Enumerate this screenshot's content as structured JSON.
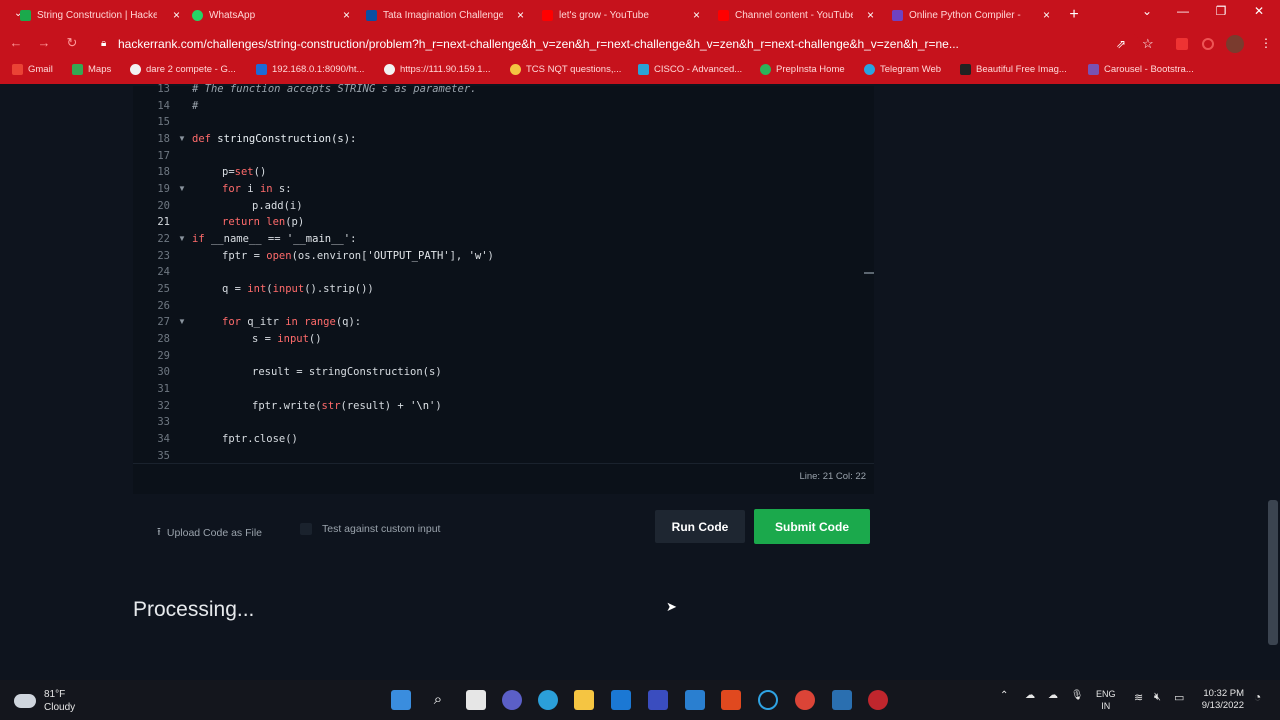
{
  "browser": {
    "tabs": [
      {
        "title": "String Construction | Hackerrank",
        "color": "#1ba94c"
      },
      {
        "title": "WhatsApp",
        "color": "#25d366"
      },
      {
        "title": "Tata Imagination Challenge",
        "color": "#0b4ea2"
      },
      {
        "title": "let's grow - YouTube",
        "color": "#ff0000"
      },
      {
        "title": "Channel content - YouTube",
        "color": "#ff0000"
      },
      {
        "title": "Online Python Compiler - ",
        "color": "#6f42c1"
      }
    ],
    "url": "hackerrank.com/challenges/string-construction/problem?h_r=next-challenge&h_v=zen&h_r=next-challenge&h_v=zen&h_r=next-challenge&h_v=zen&h_r=ne...",
    "bookmarks": [
      {
        "label": "Gmail"
      },
      {
        "label": "Maps"
      },
      {
        "label": "dare 2 compete - G..."
      },
      {
        "label": "192.168.0.1:8090/ht..."
      },
      {
        "label": "https://111.90.159.1..."
      },
      {
        "label": "TCS NQT questions,..."
      },
      {
        "label": "CISCO - Advanced..."
      },
      {
        "label": "PrepInsta Home"
      },
      {
        "label": "Telegram Web"
      },
      {
        "label": "Beautiful Free Imag..."
      },
      {
        "label": "Carousel - Bootstra..."
      }
    ]
  },
  "editor": {
    "lines": [
      {
        "num": "13",
        "code": "# The function accepts STRING s as parameter."
      },
      {
        "num": "14",
        "code": "#"
      },
      {
        "num": "15",
        "code": ""
      },
      {
        "num": "18",
        "code": "def stringConstruction(s):"
      },
      {
        "num": "17",
        "code": ""
      },
      {
        "num": "18",
        "code": "    p=set()"
      },
      {
        "num": "19",
        "code": "    for i in s:"
      },
      {
        "num": "20",
        "code": "        p.add(i)"
      },
      {
        "num": "21",
        "code": "    return len(p)"
      },
      {
        "num": "22",
        "code": "if __name__ == '__main__':"
      },
      {
        "num": "23",
        "code": "    fptr = open(os.environ['OUTPUT_PATH'], 'w')"
      },
      {
        "num": "24",
        "code": ""
      },
      {
        "num": "25",
        "code": "    q = int(input().strip())"
      },
      {
        "num": "26",
        "code": ""
      },
      {
        "num": "27",
        "code": "    for q_itr in range(q):"
      },
      {
        "num": "28",
        "code": "        s = input()"
      },
      {
        "num": "29",
        "code": ""
      },
      {
        "num": "30",
        "code": "        result = stringConstruction(s)"
      },
      {
        "num": "31",
        "code": ""
      },
      {
        "num": "32",
        "code": "        fptr.write(str(result) + '\\n')"
      },
      {
        "num": "33",
        "code": ""
      },
      {
        "num": "34",
        "code": "    fptr.close()"
      },
      {
        "num": "35",
        "code": ""
      }
    ],
    "status": "Line: 21  Col: 22"
  },
  "actions": {
    "upload": "Upload Code as File",
    "custom_input": "Test against custom input",
    "run": "Run Code",
    "submit": "Submit Code"
  },
  "processing": "Processing...",
  "taskbar": {
    "temp": "81°F",
    "condition": "Cloudy",
    "lang1": "ENG",
    "lang2": "IN",
    "time": "10:32 PM",
    "date": "9/13/2022"
  }
}
